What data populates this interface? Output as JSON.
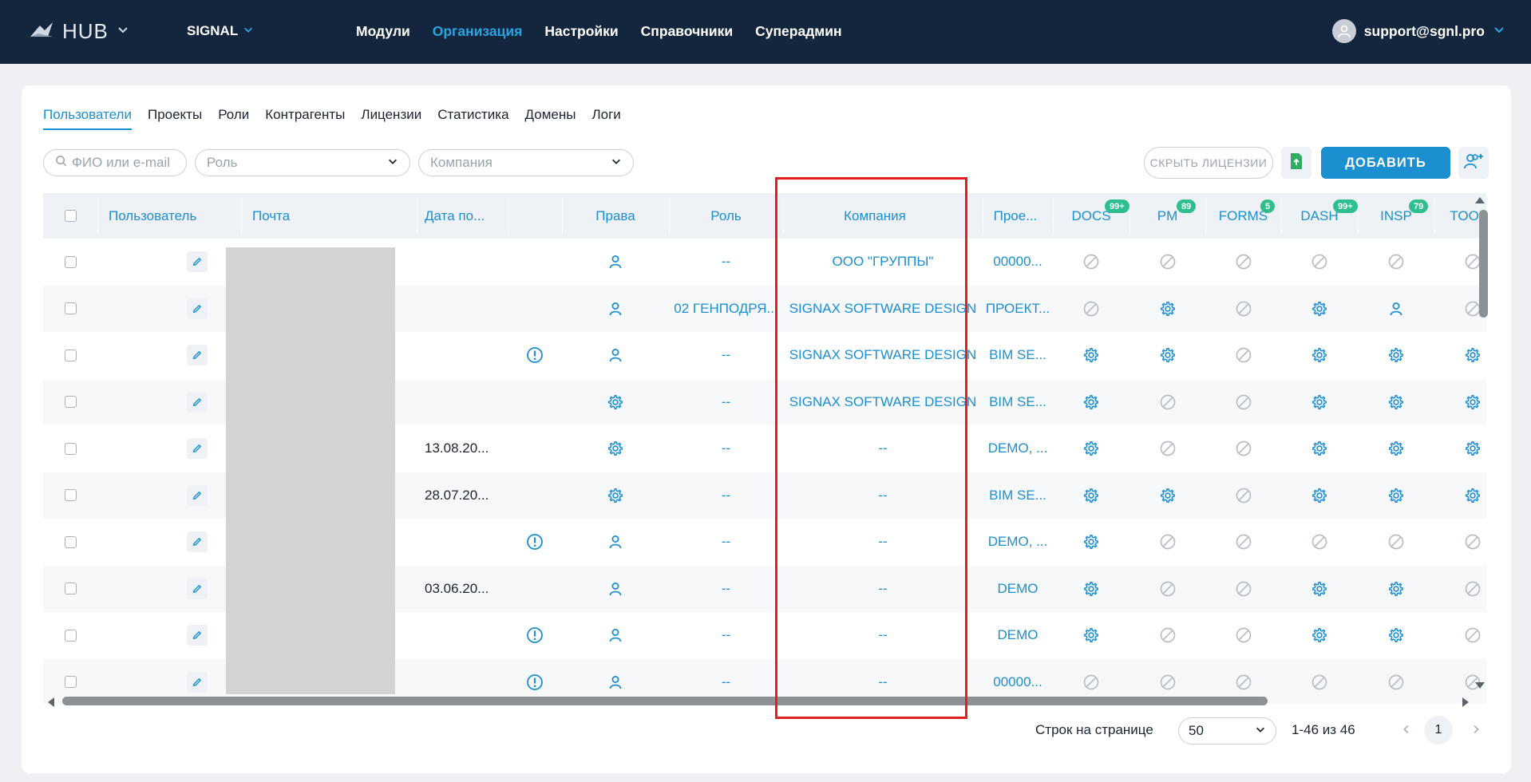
{
  "app": {
    "name": "HUB",
    "workspace": "SIGNAL",
    "user_email": "support@sgnl.pro"
  },
  "nav": [
    "Модули",
    "Организация",
    "Настройки",
    "Справочники",
    "Суперадмин"
  ],
  "tabs": [
    "Пользователи",
    "Проекты",
    "Роли",
    "Контрагенты",
    "Лицензии",
    "Статистика",
    "Домены",
    "Логи"
  ],
  "filters": {
    "search_placeholder": "ФИО или e-mail",
    "role_placeholder": "Роль",
    "company_placeholder": "Компания"
  },
  "buttons": {
    "hide_licenses": "СКРЫТЬ ЛИЦЕНЗИИ",
    "add": "ДОБАВИТЬ"
  },
  "columns": {
    "user": "Пользователь",
    "email": "Почта",
    "date": "Дата по...",
    "rights": "Права",
    "role": "Роль",
    "company": "Компания",
    "projects": "Прое...",
    "docs": "DOCS",
    "pm": "PM",
    "forms": "FORMS",
    "dash": "DASH",
    "insp": "INSP",
    "tools": "TOOLS"
  },
  "badges": {
    "docs": "99+",
    "pm": "89",
    "forms": "5",
    "dash": "99+",
    "insp": "79"
  },
  "rows": [
    {
      "date": "",
      "warn": false,
      "rights": "user",
      "role": "--",
      "company": "ООО \"ГРУППЫ\"",
      "projects": "00000...",
      "mods": [
        "off",
        "off",
        "off",
        "off",
        "off",
        "off"
      ]
    },
    {
      "date": "",
      "warn": false,
      "rights": "user",
      "role": "02 ГЕНПОДРЯ...",
      "company": "SIGNAX SOFTWARE DESIGN",
      "projects": "ПРОЕКТ...",
      "mods": [
        "off",
        "gear",
        "off",
        "gear",
        "user",
        "off"
      ]
    },
    {
      "date": "",
      "warn": true,
      "rights": "user",
      "role": "--",
      "company": "SIGNAX SOFTWARE DESIGN",
      "projects": "BIM SE...",
      "mods": [
        "gear",
        "gear",
        "off",
        "gear",
        "gear",
        "gear"
      ]
    },
    {
      "date": "",
      "warn": false,
      "rights": "gear",
      "role": "--",
      "company": "SIGNAX SOFTWARE DESIGN",
      "projects": "BIM SE...",
      "mods": [
        "gear",
        "off",
        "off",
        "gear",
        "gear",
        "gear"
      ]
    },
    {
      "date": "13.08.20...",
      "warn": false,
      "rights": "gear",
      "role": "--",
      "company": "--",
      "projects": "DEMO, ...",
      "mods": [
        "gear",
        "off",
        "off",
        "gear",
        "gear",
        "gear"
      ]
    },
    {
      "date": "28.07.20...",
      "warn": false,
      "rights": "gear",
      "role": "--",
      "company": "--",
      "projects": "BIM SE...",
      "mods": [
        "gear",
        "gear",
        "off",
        "gear",
        "gear",
        "gear"
      ]
    },
    {
      "date": "",
      "warn": true,
      "rights": "user",
      "role": "--",
      "company": "--",
      "projects": "DEMO, ...",
      "mods": [
        "gear",
        "off",
        "off",
        "off",
        "off",
        "off"
      ]
    },
    {
      "date": "03.06.20...",
      "warn": false,
      "rights": "user",
      "role": "--",
      "company": "--",
      "projects": "DEMO",
      "mods": [
        "gear",
        "off",
        "off",
        "gear",
        "gear",
        "off"
      ]
    },
    {
      "date": "",
      "warn": true,
      "rights": "user",
      "role": "--",
      "company": "--",
      "projects": "DEMO",
      "mods": [
        "gear",
        "off",
        "off",
        "gear",
        "gear",
        "off"
      ]
    },
    {
      "date": "",
      "warn": true,
      "rights": "user",
      "role": "--",
      "company": "--",
      "projects": "00000...",
      "mods": [
        "off",
        "off",
        "off",
        "off",
        "off",
        "off"
      ]
    }
  ],
  "pagination": {
    "rows_label": "Строк на странице",
    "rows_value": "50",
    "range": "1-46 из 46",
    "page": "1"
  },
  "colors": {
    "topbar": "#13263d",
    "accent": "#1c8fd0",
    "badge": "#2fbf8f",
    "highlight": "#e02020"
  }
}
